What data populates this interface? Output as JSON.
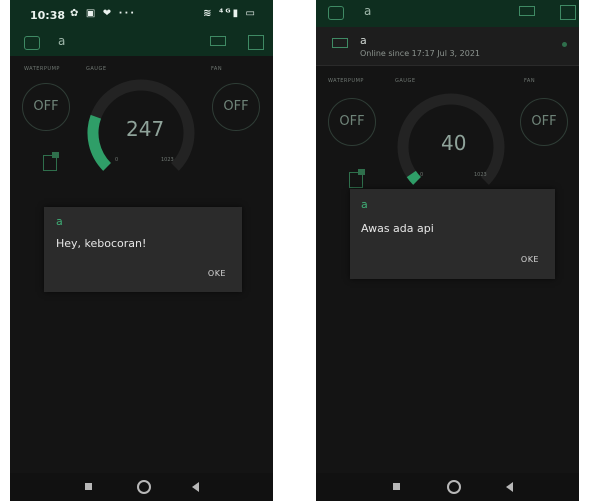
{
  "left": {
    "status": {
      "time": "10:38",
      "notif_icons": "✿ ▣ ❤ ···",
      "sys_icons": "≋ ⁴ᴳ▮ ▭"
    },
    "appbar": {
      "title": "a"
    },
    "labels": {
      "water_pump": "WATERPUMP",
      "gauge": "GAUGE",
      "fan": "FAN"
    },
    "water_pump_button": "OFF",
    "fan_button": "OFF",
    "gauge": {
      "value": "247",
      "min": "0",
      "max": "1023",
      "fraction": 0.24
    },
    "dialog": {
      "title": "a",
      "message": "Hey, kebocoran!",
      "ok": "OKE"
    }
  },
  "right": {
    "appbar": {
      "title": "a"
    },
    "device": {
      "name": "a",
      "status": "Online since 17:17 Jul 3, 2021"
    },
    "labels": {
      "water_pump": "WATERPUMP",
      "gauge": "GAUGE",
      "fan": "FAN"
    },
    "water_pump_button": "OFF",
    "fan_button": "OFF",
    "gauge": {
      "value": "40",
      "min": "0",
      "max": "1023",
      "fraction": 0.04
    },
    "dialog": {
      "title": "a",
      "message": "Awas ada api",
      "ok": "OKE"
    }
  },
  "colors": {
    "accent": "#2f9e68",
    "header": "#0e2e1f",
    "background": "#141414",
    "dialog": "#2b2b2b"
  }
}
